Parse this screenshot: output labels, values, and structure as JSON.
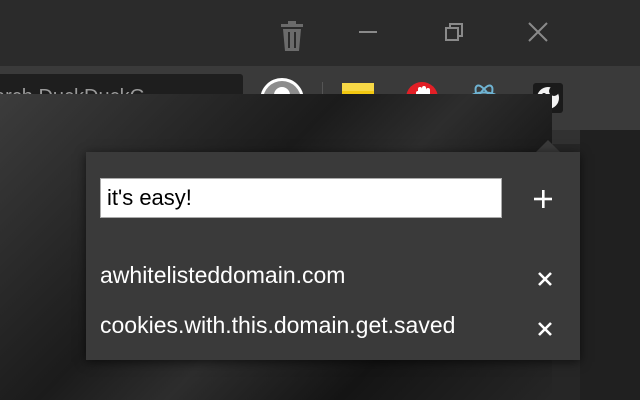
{
  "window": {
    "buttons": [
      {
        "name": "trash-icon"
      },
      {
        "name": "minimize-icon"
      },
      {
        "name": "restore-icon"
      },
      {
        "name": "close-icon"
      }
    ]
  },
  "omnibox": {
    "placeholder": "arch DuckDuckG"
  },
  "extensions": [
    {
      "name": "profile-avatar-icon"
    },
    {
      "name": "password-manager-icon",
      "color": "#f2c811"
    },
    {
      "name": "stop-hand-icon",
      "color": "#e21f26"
    },
    {
      "name": "react-atom-icon",
      "color": "#6fb3d2"
    },
    {
      "name": "cookie-icon"
    }
  ],
  "popup": {
    "input_value": "it's easy!",
    "add_label": "+",
    "domains": [
      {
        "label": "awhitelisteddomain.com"
      },
      {
        "label": "cookies.with.this.domain.get.saved"
      }
    ],
    "remove_label": "×"
  },
  "colors": {
    "titlebar": "#2b2b2b",
    "toolbar": "#3a3a3a",
    "popup_bg": "#3a3a3a",
    "text": "#ffffff"
  }
}
